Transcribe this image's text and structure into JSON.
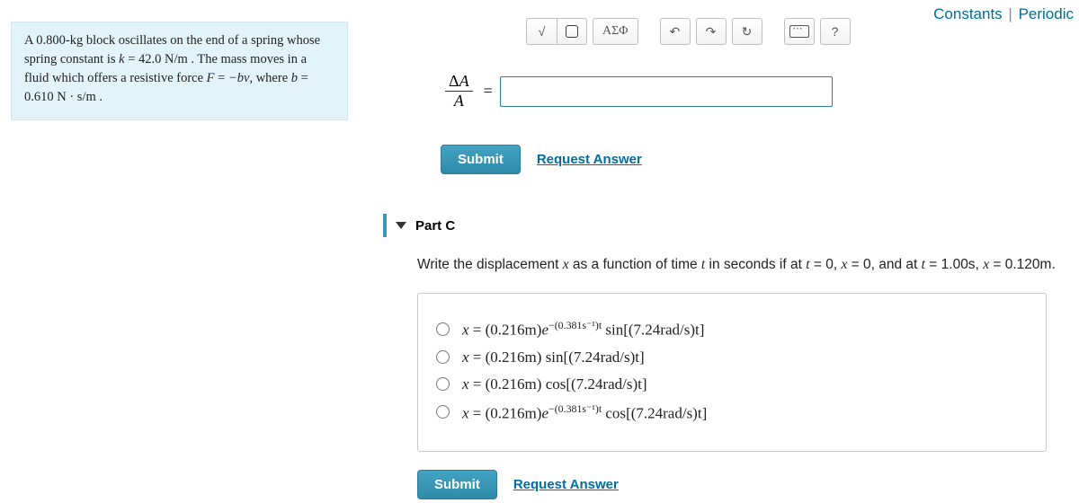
{
  "topLinks": {
    "constants": "Constants",
    "periodic": "Periodic",
    "sep": "|"
  },
  "problem": {
    "line1a": "A ",
    "mass": "0.800-kg",
    "line1b": " block oscillates on the end of a spring whose spring constant is ",
    "kvar": "k",
    "keq": " = ",
    "kval": "42.0 N/m",
    "line1c": " . The mass moves in a fluid which offers a resistive force ",
    "Fvar": "F",
    "Feq": " = ",
    "bv": "−bv",
    "where": ", where ",
    "bvar": "b",
    "beq": " = ",
    "bval": "0.610 N · s/m",
    "end": " ."
  },
  "toolbar": {
    "sqrt": "√",
    "greek": "ΑΣΦ",
    "undo": "↶",
    "redo": "↷",
    "reset": "↻",
    "help": "?"
  },
  "answer": {
    "num": "ΔA",
    "den": "A",
    "eq": "="
  },
  "buttons": {
    "submit": "Submit",
    "request": "Request Answer"
  },
  "partC": {
    "label": "Part C",
    "prompt_a": "Write the displacement ",
    "xvar": "x",
    "prompt_b": " as a function of time ",
    "tvar": "t",
    "prompt_c": " in seconds if at ",
    "t0": "t",
    "eq0": " = 0, ",
    "x0": "x",
    "eq0b": " = 0, and at ",
    "t1": "t",
    "eq1": " = ",
    "t1v": "1.00s",
    "comma": ", ",
    "x1": "x",
    "eq1b": " = ",
    "x1v": "0.120m",
    "dot": "."
  },
  "choices": [
    {
      "x": "x",
      "eq": " = ",
      "a": "(0.216m)",
      "exp": "e",
      "pow": "−(0.381s⁻¹)t",
      "sp": " ",
      "trig": "sin",
      "arg": "[(7.24rad/s)t]"
    },
    {
      "x": "x",
      "eq": " = ",
      "a": "(0.216m) ",
      "trig": "sin",
      "arg": "[(7.24rad/s)t]"
    },
    {
      "x": "x",
      "eq": " = ",
      "a": "(0.216m) ",
      "trig": "cos",
      "arg": "[(7.24rad/s)t]"
    },
    {
      "x": "x",
      "eq": " = ",
      "a": "(0.216m)",
      "exp": "e",
      "pow": "−(0.381s⁻¹)t",
      "sp": " ",
      "trig": "cos",
      "arg": "[(7.24rad/s)t]"
    }
  ]
}
